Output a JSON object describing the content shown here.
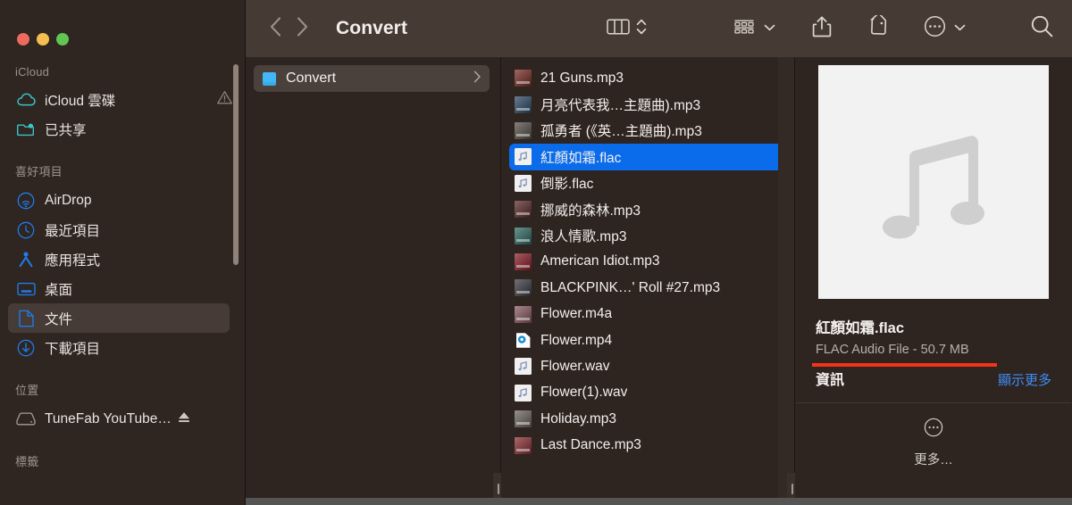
{
  "window": {
    "traffic_lights": [
      "close",
      "minimize",
      "maximize"
    ],
    "colors": {
      "close": "#ed6a5f",
      "minimize": "#f5bf4f",
      "maximize": "#61c554",
      "selection_blue": "#0a6ceb",
      "link_blue": "#3f8ef7",
      "annotation_red": "#f5331a",
      "toolbar_bg": "#453a34",
      "window_bg": "#2e2420",
      "sidebar_bg": "#2f2521"
    }
  },
  "toolbar": {
    "back_icon": "chevron-left-icon",
    "forward_icon": "chevron-right-icon",
    "title": "Convert",
    "view_column_icon": "column-view-icon",
    "view_stepper_icon": "up-down-chevron-icon",
    "group_icon": "group-items-icon",
    "group_chevron_icon": "chevron-down-icon",
    "share_icon": "share-icon",
    "tag_icon": "tag-icon",
    "more_icon": "ellipsis-circle-icon",
    "more_chevron_icon": "chevron-down-icon",
    "search_icon": "search-icon"
  },
  "sidebar": {
    "sections": [
      {
        "header": "iCloud",
        "items": [
          {
            "label": "iCloud 雲碟",
            "icon": "cloud-icon",
            "badge": "warning-triangle-icon",
            "active": false
          },
          {
            "label": "已共享",
            "icon": "shared-folder-icon",
            "badge": "",
            "active": false
          }
        ]
      },
      {
        "header": "喜好項目",
        "items": [
          {
            "label": "AirDrop",
            "icon": "airdrop-icon",
            "badge": "",
            "active": false
          },
          {
            "label": "最近項目",
            "icon": "clock-icon",
            "badge": "",
            "active": false
          },
          {
            "label": "應用程式",
            "icon": "applications-icon",
            "badge": "",
            "active": false
          },
          {
            "label": "桌面",
            "icon": "desktop-icon",
            "badge": "",
            "active": false
          },
          {
            "label": "文件",
            "icon": "document-icon",
            "badge": "",
            "active": true
          },
          {
            "label": "下載項目",
            "icon": "downloads-icon",
            "badge": "",
            "active": false
          }
        ]
      },
      {
        "header": "位置",
        "items": [
          {
            "label": "TuneFab YouTube…",
            "icon": "external-drive-icon",
            "badge": "eject-icon",
            "active": false
          }
        ]
      },
      {
        "header": "標籤",
        "items": []
      }
    ]
  },
  "folder_column": {
    "rows": [
      {
        "name": "Convert",
        "icon": "folder-icon",
        "chevron": "chevron-right-icon",
        "active": true
      }
    ]
  },
  "file_column": {
    "files": [
      {
        "name": "21 Guns.mp3",
        "icon": "album-art-thumbnail",
        "art": "#7a2c24",
        "selected": false
      },
      {
        "name": "月亮代表我…主題曲).mp3",
        "icon": "album-art-thumbnail",
        "art": "#2c4a66",
        "selected": false
      },
      {
        "name": "孤勇者 (《英…主題曲).mp3",
        "icon": "album-art-thumbnail",
        "art": "#565049",
        "selected": false
      },
      {
        "name": "紅顏如霜.flac",
        "icon": "music-note-file-icon",
        "art": "#eeeeee",
        "selected": true
      },
      {
        "name": "倒影.flac",
        "icon": "music-note-file-icon",
        "art": "#eeeeee",
        "selected": false
      },
      {
        "name": "挪威的森林.mp3",
        "icon": "album-art-thumbnail",
        "art": "#5c2a2a",
        "selected": false
      },
      {
        "name": "浪人情歌.mp3",
        "icon": "album-art-thumbnail",
        "art": "#2e6b66",
        "selected": false
      },
      {
        "name": "American Idiot.mp3",
        "icon": "album-art-thumbnail",
        "art": "#8e1d28",
        "selected": false
      },
      {
        "name": "BLACKPINK…' Roll #27.mp3",
        "icon": "album-art-thumbnail",
        "art": "#3a3a42",
        "selected": false
      },
      {
        "name": "Flower.m4a",
        "icon": "album-art-thumbnail",
        "art": "#8b5a63",
        "selected": false
      },
      {
        "name": "Flower.mp4",
        "icon": "video-file-icon",
        "art": "#ffffff",
        "selected": false
      },
      {
        "name": "Flower.wav",
        "icon": "music-note-file-icon",
        "art": "#eeeeee",
        "selected": false
      },
      {
        "name": "Flower(1).wav",
        "icon": "music-note-file-icon",
        "art": "#eeeeee",
        "selected": false
      },
      {
        "name": "Holiday.mp3",
        "icon": "album-art-thumbnail",
        "art": "#6e6660",
        "selected": false
      },
      {
        "name": "Last Dance.mp3",
        "icon": "album-art-thumbnail",
        "art": "#8c2f33",
        "selected": false
      }
    ]
  },
  "preview": {
    "artwork_icon": "music-note-icon",
    "file_name": "紅顏如霜.flac",
    "file_meta": "FLAC Audio File - 50.7 MB",
    "info_label": "資訊",
    "show_more_label": "顯示更多",
    "more_icon": "ellipsis-circle-icon",
    "more_label": "更多…"
  }
}
